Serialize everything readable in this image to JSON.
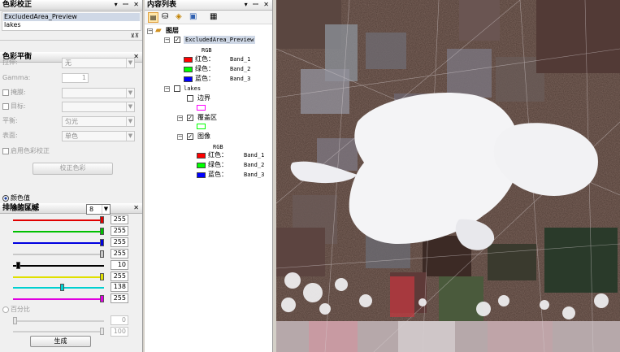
{
  "colorCorrection": {
    "title": "色彩校正",
    "layers": [
      "ExcludedArea_Preview",
      "lakes"
    ]
  },
  "colorBalance": {
    "title": "色彩平衡",
    "stretch_label": "拉伸:",
    "stretch_value": "无",
    "gamma_label": "Gamma:",
    "gamma_value": "1",
    "mask_label": "掩膜:",
    "target_label": "目标:",
    "balance_label": "平衡:",
    "balance_value": "匀光",
    "surface_label": "表面:",
    "surface_value": "单色",
    "enable_label": "启用色彩校正",
    "correct_button": "校正色彩"
  },
  "exclusion": {
    "title": "排除的区域",
    "color_value_label": "颜色值",
    "pixel_depth_label": "像素深度:",
    "pixel_depth_value": "8",
    "sliders": [
      {
        "color": "#e00000",
        "value": "255",
        "level": 1.0
      },
      {
        "color": "#00c000",
        "value": "255",
        "level": 1.0
      },
      {
        "color": "#0000e0",
        "value": "255",
        "level": 1.0
      },
      {
        "color": "#c8c8c8",
        "value": "255",
        "level": 1.0
      },
      {
        "color": "#000000",
        "value": "10",
        "level": 0.04
      },
      {
        "color": "#e0e000",
        "value": "255",
        "level": 1.0
      },
      {
        "color": "#00d0d0",
        "value": "138",
        "level": 0.54
      },
      {
        "color": "#e000e0",
        "value": "255",
        "level": 1.0
      }
    ],
    "percent_label": "百分比",
    "percent_low": "0",
    "percent_high": "100",
    "generate_button": "生成"
  },
  "toc": {
    "title": "内容列表",
    "root": "图层",
    "layer1": "ExcludedArea_Preview",
    "rgb": "RGB",
    "bands": [
      {
        "label": "红色：",
        "band": "Band_1",
        "color": "#ff0000"
      },
      {
        "label": "绿色：",
        "band": "Band_2",
        "color": "#00ff00"
      },
      {
        "label": "蓝色：",
        "band": "Band_3",
        "color": "#0000ff"
      }
    ],
    "layer2": "lakes",
    "boundary": "边界",
    "coverage": "覆盖区",
    "image": "图像",
    "rgb2": "RGB",
    "bands2": [
      {
        "label": "红色：",
        "band": "Band_1",
        "color": "#ff0000"
      },
      {
        "label": "绿色：",
        "band": "Band_2",
        "color": "#00ff00"
      },
      {
        "label": "蓝色：",
        "band": "Band_3",
        "color": "#0000ff"
      }
    ]
  }
}
